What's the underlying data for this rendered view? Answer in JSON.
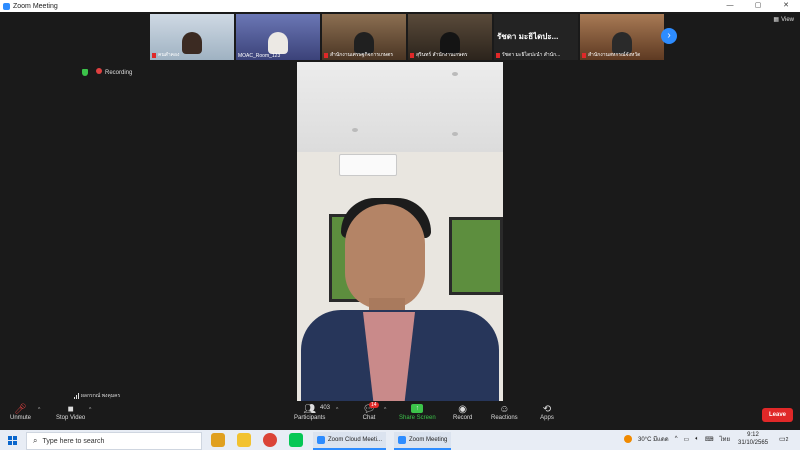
{
  "window": {
    "title": "Zoom Meeting",
    "controls": [
      "—",
      "▢",
      "✕"
    ]
  },
  "view_button": "View",
  "thumbnails": [
    {
      "label": "คนสำคอง"
    },
    {
      "label": "MOAC_Room_123"
    },
    {
      "label": "สำนักงานเศรษฐกิจการเกษตร"
    },
    {
      "label": "สุรินทร์ สำนักงานเกษตร"
    },
    {
      "big_text": "รัชดา มะธิไดปะ...",
      "label": "รัชดา มะธิไดปะนำ สำนัก..."
    },
    {
      "label": "สำนักงานสหกรณ์จังหวัด"
    }
  ],
  "status": {
    "recording": "Recording"
  },
  "speaker_name": "ผลกรกณ์ พงคุมคร",
  "controls": {
    "unmute": "Unmute",
    "stop_video": "Stop Video",
    "participants": "Participants",
    "participants_count": "403",
    "chat": "Chat",
    "chat_badge": "14",
    "share_screen": "Share Screen",
    "record": "Record",
    "reactions": "Reactions",
    "apps": "Apps",
    "leave": "Leave"
  },
  "taskbar": {
    "search_placeholder": "Type here to search",
    "tasks": [
      "Zoom Cloud Meeti...",
      "Zoom Meeting"
    ],
    "weather": "30°C มีแดด",
    "lang": "ไทย",
    "time": "9:12",
    "date": "31/10/2565",
    "notif_count": "2"
  },
  "colors": {
    "accent": "#2d8cff",
    "leave": "#e02828",
    "share": "#3cc34a"
  }
}
